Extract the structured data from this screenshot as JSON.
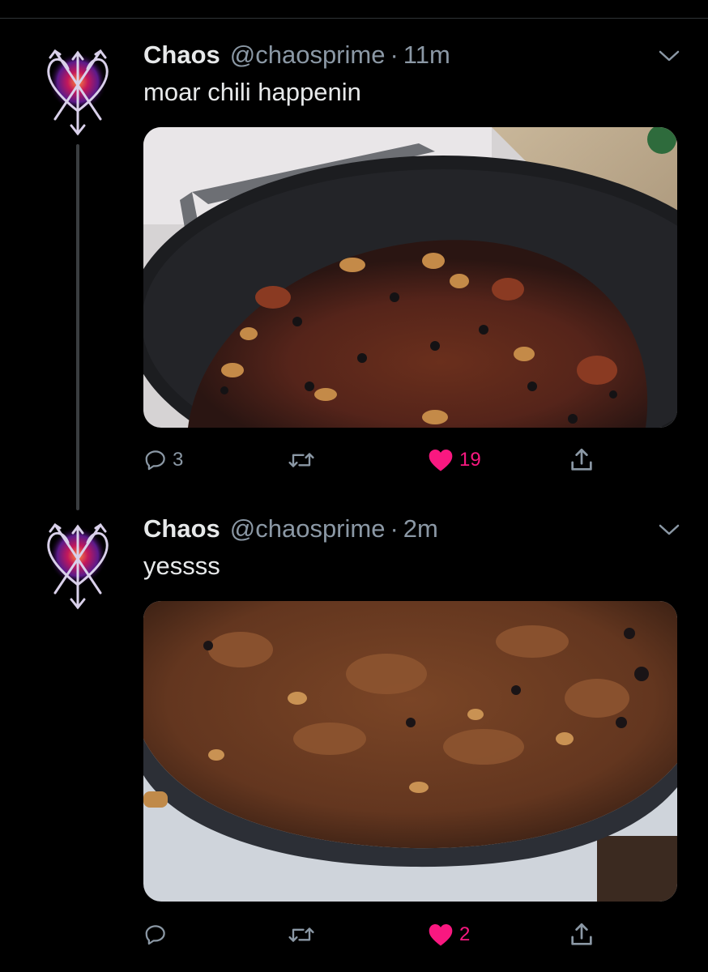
{
  "tweets": [
    {
      "name": "Chaos",
      "handle": "@chaosprime",
      "separator": "·",
      "time": "11m",
      "text": "moar chili happenin",
      "media_alt": "pot of chili on stove",
      "replies": "3",
      "retweets": "",
      "likes": "19",
      "liked": true
    },
    {
      "name": "Chaos",
      "handle": "@chaosprime",
      "separator": "·",
      "time": "2m",
      "text": "yessss",
      "media_alt": "close-up of chili in pot",
      "replies": "",
      "retweets": "",
      "likes": "2",
      "liked": true
    }
  ],
  "colors": {
    "background": "#000000",
    "primary_text": "#e7e9ea",
    "secondary_text": "#8b98a5",
    "like": "#f91880"
  },
  "icons": [
    "avatar-sigil",
    "chevron-down-icon",
    "reply-icon",
    "retweet-icon",
    "heart-icon",
    "share-icon"
  ]
}
